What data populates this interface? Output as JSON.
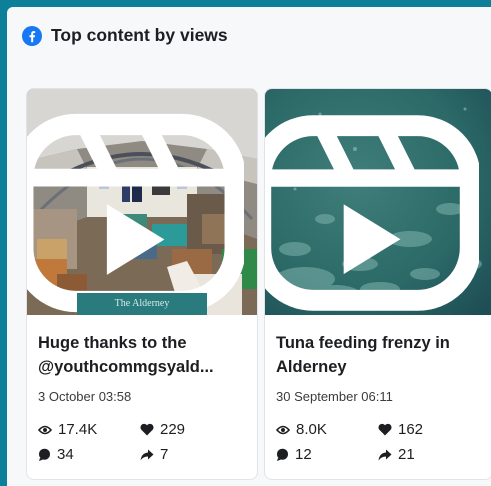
{
  "header": {
    "title": "Top content by views",
    "icon": "facebook-icon",
    "brand_color": "#1877f2"
  },
  "posts": [
    {
      "title_line1": "Huge thanks to the",
      "title_line2": "@youthcommgsyald...",
      "date": "3 October 03:58",
      "overlay_text": "The Alderney",
      "views": "17.4K",
      "likes": "229",
      "comments": "34",
      "shares": "7",
      "media_icon": "reels-icon"
    },
    {
      "title_line1": "Tuna feeding frenzy in",
      "title_line2": "Alderney",
      "date": "30 September 06:11",
      "views": "8.0K",
      "likes": "162",
      "comments": "12",
      "shares": "21",
      "media_icon": "reels-icon"
    }
  ],
  "colors": {
    "frame": "#0e7f98",
    "panel": "#f7f8fa",
    "card": "#ffffff"
  }
}
